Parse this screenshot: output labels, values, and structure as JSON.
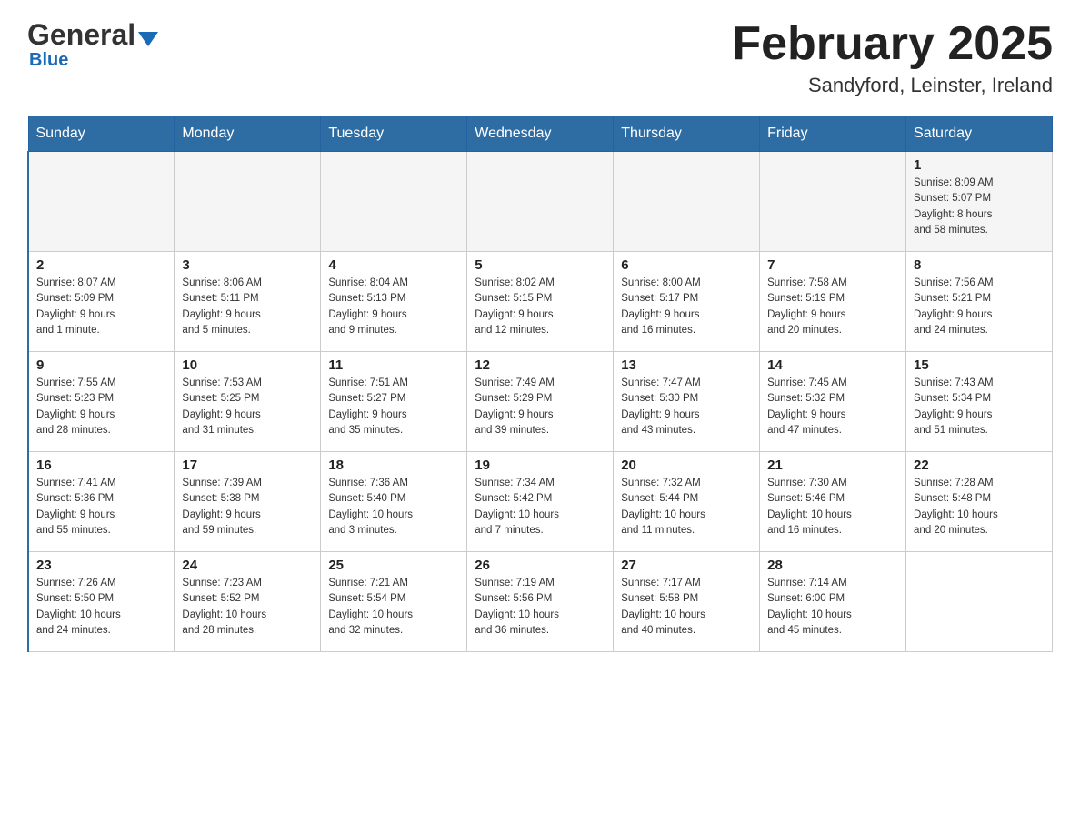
{
  "header": {
    "logo_general": "General",
    "logo_blue": "Blue",
    "month_title": "February 2025",
    "location": "Sandyford, Leinster, Ireland"
  },
  "weekdays": [
    "Sunday",
    "Monday",
    "Tuesday",
    "Wednesday",
    "Thursday",
    "Friday",
    "Saturday"
  ],
  "weeks": [
    [
      {
        "day": "",
        "info": ""
      },
      {
        "day": "",
        "info": ""
      },
      {
        "day": "",
        "info": ""
      },
      {
        "day": "",
        "info": ""
      },
      {
        "day": "",
        "info": ""
      },
      {
        "day": "",
        "info": ""
      },
      {
        "day": "1",
        "info": "Sunrise: 8:09 AM\nSunset: 5:07 PM\nDaylight: 8 hours\nand 58 minutes."
      }
    ],
    [
      {
        "day": "2",
        "info": "Sunrise: 8:07 AM\nSunset: 5:09 PM\nDaylight: 9 hours\nand 1 minute."
      },
      {
        "day": "3",
        "info": "Sunrise: 8:06 AM\nSunset: 5:11 PM\nDaylight: 9 hours\nand 5 minutes."
      },
      {
        "day": "4",
        "info": "Sunrise: 8:04 AM\nSunset: 5:13 PM\nDaylight: 9 hours\nand 9 minutes."
      },
      {
        "day": "5",
        "info": "Sunrise: 8:02 AM\nSunset: 5:15 PM\nDaylight: 9 hours\nand 12 minutes."
      },
      {
        "day": "6",
        "info": "Sunrise: 8:00 AM\nSunset: 5:17 PM\nDaylight: 9 hours\nand 16 minutes."
      },
      {
        "day": "7",
        "info": "Sunrise: 7:58 AM\nSunset: 5:19 PM\nDaylight: 9 hours\nand 20 minutes."
      },
      {
        "day": "8",
        "info": "Sunrise: 7:56 AM\nSunset: 5:21 PM\nDaylight: 9 hours\nand 24 minutes."
      }
    ],
    [
      {
        "day": "9",
        "info": "Sunrise: 7:55 AM\nSunset: 5:23 PM\nDaylight: 9 hours\nand 28 minutes."
      },
      {
        "day": "10",
        "info": "Sunrise: 7:53 AM\nSunset: 5:25 PM\nDaylight: 9 hours\nand 31 minutes."
      },
      {
        "day": "11",
        "info": "Sunrise: 7:51 AM\nSunset: 5:27 PM\nDaylight: 9 hours\nand 35 minutes."
      },
      {
        "day": "12",
        "info": "Sunrise: 7:49 AM\nSunset: 5:29 PM\nDaylight: 9 hours\nand 39 minutes."
      },
      {
        "day": "13",
        "info": "Sunrise: 7:47 AM\nSunset: 5:30 PM\nDaylight: 9 hours\nand 43 minutes."
      },
      {
        "day": "14",
        "info": "Sunrise: 7:45 AM\nSunset: 5:32 PM\nDaylight: 9 hours\nand 47 minutes."
      },
      {
        "day": "15",
        "info": "Sunrise: 7:43 AM\nSunset: 5:34 PM\nDaylight: 9 hours\nand 51 minutes."
      }
    ],
    [
      {
        "day": "16",
        "info": "Sunrise: 7:41 AM\nSunset: 5:36 PM\nDaylight: 9 hours\nand 55 minutes."
      },
      {
        "day": "17",
        "info": "Sunrise: 7:39 AM\nSunset: 5:38 PM\nDaylight: 9 hours\nand 59 minutes."
      },
      {
        "day": "18",
        "info": "Sunrise: 7:36 AM\nSunset: 5:40 PM\nDaylight: 10 hours\nand 3 minutes."
      },
      {
        "day": "19",
        "info": "Sunrise: 7:34 AM\nSunset: 5:42 PM\nDaylight: 10 hours\nand 7 minutes."
      },
      {
        "day": "20",
        "info": "Sunrise: 7:32 AM\nSunset: 5:44 PM\nDaylight: 10 hours\nand 11 minutes."
      },
      {
        "day": "21",
        "info": "Sunrise: 7:30 AM\nSunset: 5:46 PM\nDaylight: 10 hours\nand 16 minutes."
      },
      {
        "day": "22",
        "info": "Sunrise: 7:28 AM\nSunset: 5:48 PM\nDaylight: 10 hours\nand 20 minutes."
      }
    ],
    [
      {
        "day": "23",
        "info": "Sunrise: 7:26 AM\nSunset: 5:50 PM\nDaylight: 10 hours\nand 24 minutes."
      },
      {
        "day": "24",
        "info": "Sunrise: 7:23 AM\nSunset: 5:52 PM\nDaylight: 10 hours\nand 28 minutes."
      },
      {
        "day": "25",
        "info": "Sunrise: 7:21 AM\nSunset: 5:54 PM\nDaylight: 10 hours\nand 32 minutes."
      },
      {
        "day": "26",
        "info": "Sunrise: 7:19 AM\nSunset: 5:56 PM\nDaylight: 10 hours\nand 36 minutes."
      },
      {
        "day": "27",
        "info": "Sunrise: 7:17 AM\nSunset: 5:58 PM\nDaylight: 10 hours\nand 40 minutes."
      },
      {
        "day": "28",
        "info": "Sunrise: 7:14 AM\nSunset: 6:00 PM\nDaylight: 10 hours\nand 45 minutes."
      },
      {
        "day": "",
        "info": ""
      }
    ]
  ]
}
